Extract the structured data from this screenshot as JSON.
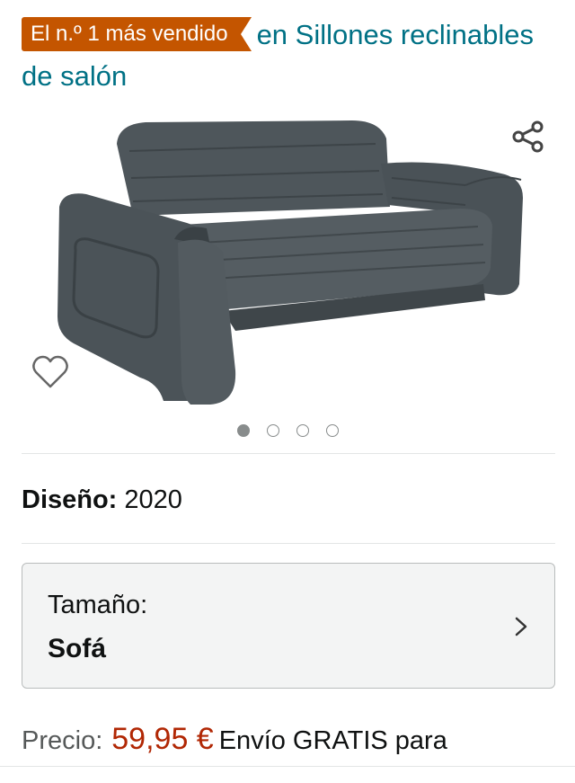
{
  "header": {
    "badge_label": "El n.º 1 más vendido",
    "category_link": "en Sillones reclinables de salón"
  },
  "image": {
    "carousel_count": 4,
    "active_index": 0,
    "share_icon": "share-icon",
    "wishlist_icon": "heart-outline-icon"
  },
  "design": {
    "label": "Diseño:",
    "value": "2020"
  },
  "size": {
    "label": "Tamaño:",
    "value": "Sofá",
    "chevron_icon": "chevron-right-icon"
  },
  "price": {
    "label": "Precio:",
    "value": "59,95 €",
    "shipping": "Envío GRATIS para"
  },
  "colors": {
    "badge": "#c45500",
    "link": "#007185",
    "price": "#b12704",
    "sofa": "#4b5358"
  }
}
